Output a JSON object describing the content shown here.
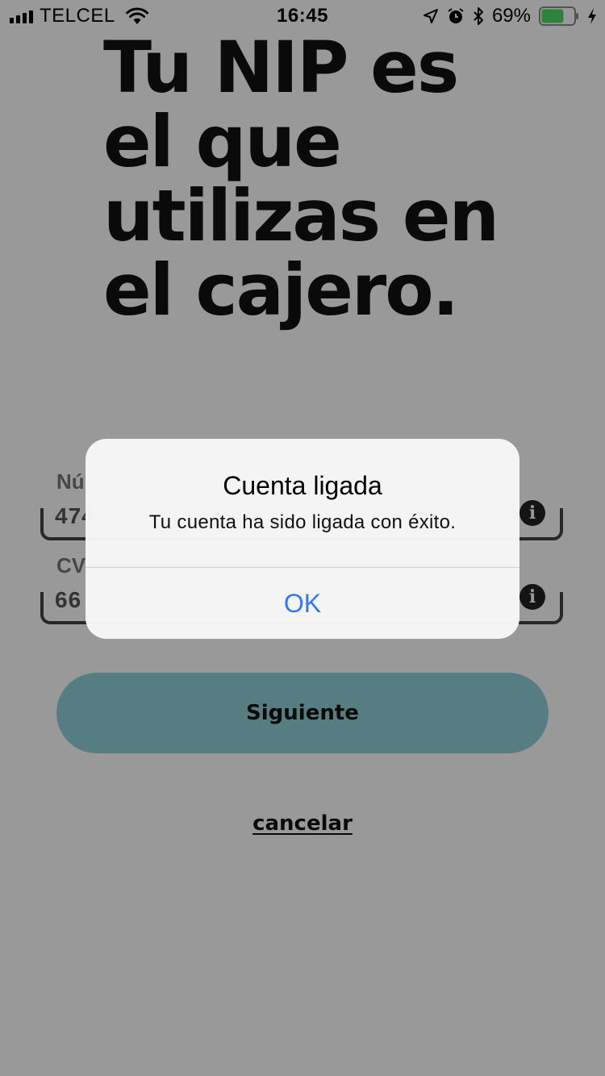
{
  "status_bar": {
    "carrier": "TELCEL",
    "time": "16:45",
    "battery_percent": "69%",
    "battery_level": 0.69,
    "icons": [
      "signal-icon",
      "wifi-icon",
      "location-icon",
      "alarm-icon",
      "bluetooth-icon",
      "battery-icon",
      "charging-icon"
    ]
  },
  "headline": {
    "line1": "Tu NIP es",
    "line2": "el que",
    "line3": "utilizas en",
    "line4": "el cajero."
  },
  "form": {
    "card_number_label": "Nú",
    "card_number_value": "474",
    "cvv_label": "CV",
    "cvv_value": "66"
  },
  "buttons": {
    "next_label": "Siguiente",
    "cancel_label": "cancelar"
  },
  "alert": {
    "title": "Cuenta ligada",
    "message": "Tu cuenta ha sido ligada con éxito.",
    "ok_label": "OK"
  },
  "colors": {
    "accent_button": "#8fd0d8",
    "alert_action": "#3478f6",
    "battery_fill": "#4cd964"
  }
}
